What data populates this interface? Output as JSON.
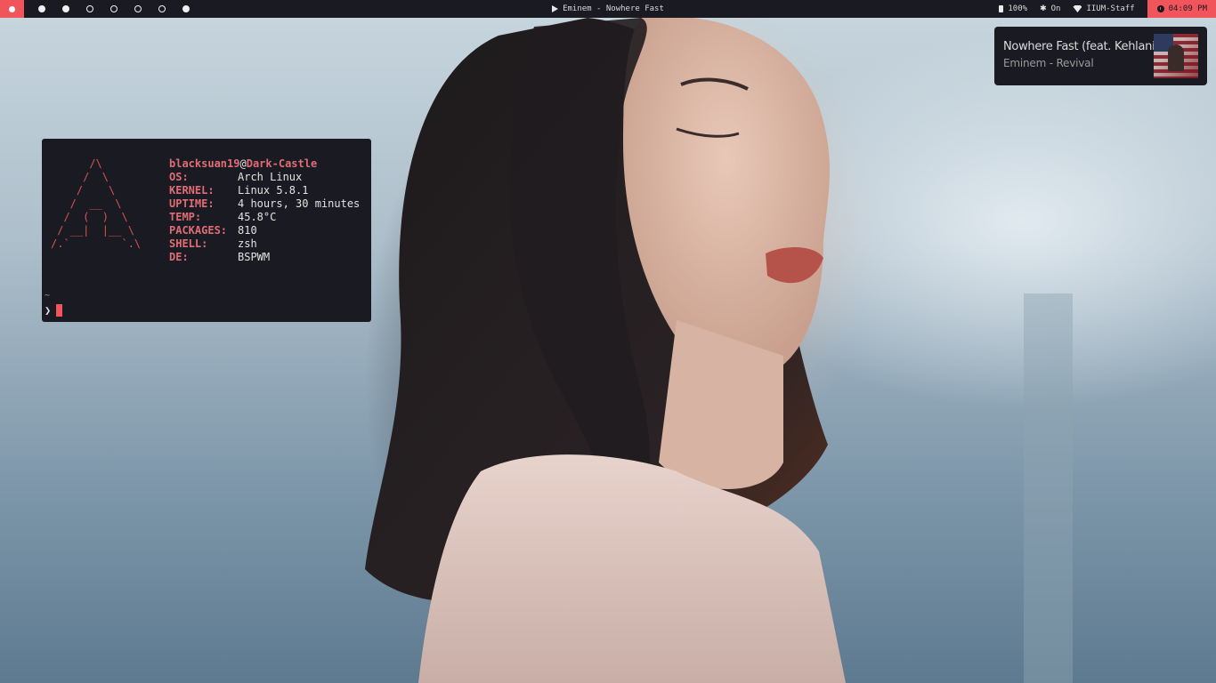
{
  "topbar": {
    "workspaces": [
      {
        "filled": true
      },
      {
        "filled": true
      },
      {
        "filled": false
      },
      {
        "filled": false
      },
      {
        "filled": false
      },
      {
        "filled": false
      },
      {
        "filled": true
      }
    ],
    "now_playing": "Eminem - Nowhere Fast",
    "battery": "100%",
    "bluetooth": "On",
    "wifi": "IIUM-Staff",
    "clock": "04:09 PM",
    "accent": "#f2545b",
    "bar_bg": "#1a1b22"
  },
  "notification": {
    "title": "Nowhere Fast (feat. Kehlani)",
    "subtitle": "Eminem - Revival"
  },
  "terminal": {
    "ascii_art": "      /\\\n     /  \\\n    /    \\\n   /  __  \\\n  /  (  )  \\\n / __|  |__ \\\n/.`        `.\\",
    "user": "blacksuan19",
    "at": "@",
    "host": "Dark-Castle",
    "rows": [
      {
        "key": "OS:",
        "value": "Arch Linux"
      },
      {
        "key": "KERNEL:",
        "value": "Linux 5.8.1"
      },
      {
        "key": "UPTIME:",
        "value": "4 hours, 30 minutes"
      },
      {
        "key": "TEMP:",
        "value": "45.8°C"
      },
      {
        "key": "PACKAGES:",
        "value": "810"
      },
      {
        "key": "SHELL:",
        "value": "zsh"
      },
      {
        "key": "DE:",
        "value": "BSPWM"
      }
    ],
    "cwd": "~",
    "prompt_symbol": "❯"
  }
}
